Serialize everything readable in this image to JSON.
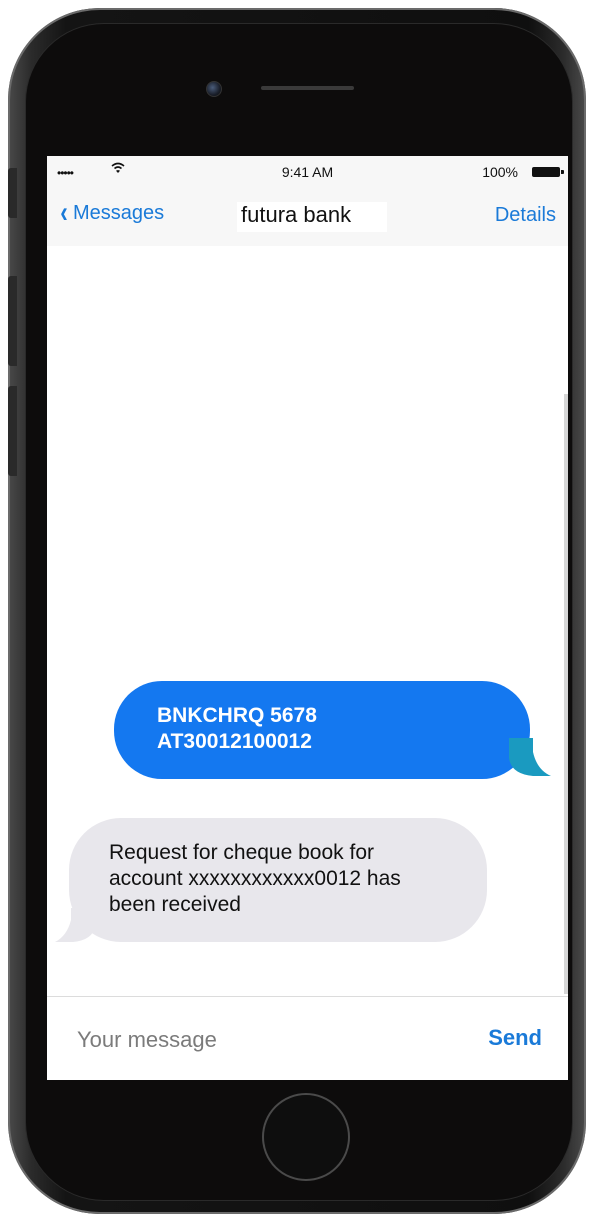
{
  "status_bar": {
    "signal": "•••••",
    "wifi_icon": "wifi-icon",
    "time": "9:41 AM",
    "battery": "100%"
  },
  "nav": {
    "back_label": "Messages",
    "back_icon": "chevron-left-icon",
    "title": "futura bank",
    "details_label": "Details"
  },
  "messages": [
    {
      "direction": "sent",
      "lines": [
        "BNKCHRQ 5678",
        "AT30012100012"
      ],
      "color": "#1478f0"
    },
    {
      "direction": "received",
      "lines": [
        "Request for cheque book for",
        "account xxxxxxxxxxxx0012 has",
        "been received"
      ],
      "color": "#e8e7ec"
    }
  ],
  "composer": {
    "placeholder": "Your message",
    "send_label": "Send"
  },
  "colors": {
    "accent": "#1a7ad8",
    "sent_bubble": "#1478f0",
    "received_bubble": "#e8e7ec",
    "sent_tail": "#1a9ac0"
  }
}
